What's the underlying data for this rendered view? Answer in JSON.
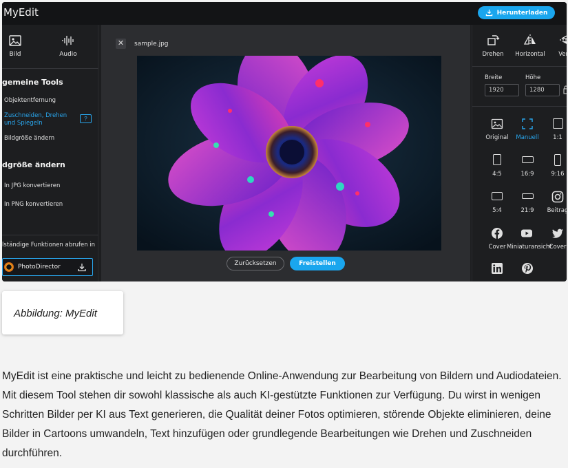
{
  "app": {
    "title": "MyEdit",
    "download_label": "Herunterladen"
  },
  "sidebar": {
    "tabs": [
      {
        "label": "Bild",
        "icon": "image-icon"
      },
      {
        "label": "Audio",
        "icon": "waveform-icon"
      }
    ],
    "section1_title": "gemeine Tools",
    "section1_items": [
      "Objektentfernung",
      "Zuschneiden, Drehen und Spiegeln",
      "Bildgröße ändern"
    ],
    "section2_title": "dgröße ändern",
    "section2_items": [
      "In JPG konvertieren",
      "In PNG konvertieren"
    ],
    "promo_text": "lständige Funktionen abrufen in",
    "promo_app": "PhotoDirector"
  },
  "canvas": {
    "file_name": "sample.jpg",
    "reset_label": "Zurücksetzen",
    "apply_label": "Freistellen"
  },
  "right_panel": {
    "tools": [
      "Drehen",
      "Horizontal",
      "Verti"
    ],
    "width_label": "Breite",
    "height_label": "Höhe",
    "width_value": "1920",
    "height_value": "1280",
    "ratios": [
      "Original",
      "Manuell",
      "1:1",
      "4:5",
      "16:9",
      "9:16",
      "5:4",
      "21:9",
      "Beitrag",
      "Cover",
      "Miniaturansicht",
      "Cover"
    ],
    "selected_ratio": "Manuell"
  },
  "caption": "Abbildung: MyEdit",
  "paragraph": "MyEdit ist eine praktische und leicht zu bedienende Online-Anwendung zur Bearbeitung von Bildern und Audiodateien. Mit diesem Tool stehen dir sowohl klassische als auch KI-gestützte Funktionen zur Verfügung. Du wirst in wenigen Schritten Bilder per KI aus Text generieren, die Qualität deiner Fotos optimieren, störende Objekte eliminieren, deine Bilder in Cartoons umwandeln, Text hinzufügen oder grundlegende Bearbeitungen wie Drehen und Zuschneiden durchführen.",
  "colors": {
    "accent": "#1aa6ee",
    "panel_bg": "#1d1e20",
    "canvas_bg": "#2c2d30"
  }
}
